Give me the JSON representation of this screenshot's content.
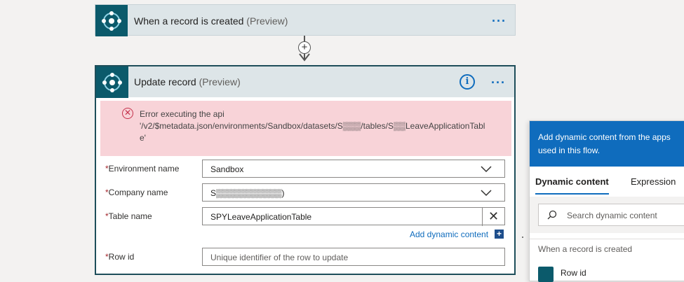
{
  "trigger_card": {
    "title": "When a record is created",
    "preview": "(Preview)",
    "more": "···"
  },
  "action_card": {
    "title": "Update record",
    "preview": "(Preview)",
    "info": "i",
    "more": "···",
    "error": {
      "line1": "Error executing the api",
      "line2": "'/v2/$metadata.json/environments/Sandbox/datasets/S▒▒▒/tables/S▒▒LeaveApplicationTabl",
      "line3": "e'"
    },
    "fields": [
      {
        "label": "Environment name",
        "value": "Sandbox"
      },
      {
        "label": "Company name",
        "value": "S▒▒▒▒▒▒▒▒▒▒▒)"
      },
      {
        "label": "Table name",
        "value": "SPYLeaveApplicationTable",
        "clear": "✕"
      },
      {
        "label": "Row id",
        "placeholder": "Unique identifier of the row to update"
      }
    ],
    "required_mark": "*",
    "add_dynamic": "Add dynamic content",
    "add_dynamic_icon": "+"
  },
  "dynamic_panel": {
    "header": "Add dynamic content from the apps used in this flow.",
    "tabs": [
      "Dynamic content",
      "Expression"
    ],
    "search_placeholder": "Search dynamic content",
    "section": "When a record is created",
    "first_item": "Row id"
  },
  "colors": {
    "accent": "#0f6cbd",
    "error_bg": "#f8d3d8",
    "header_bg": "#dde5e8",
    "logo_bg": "#0b5a6b"
  }
}
